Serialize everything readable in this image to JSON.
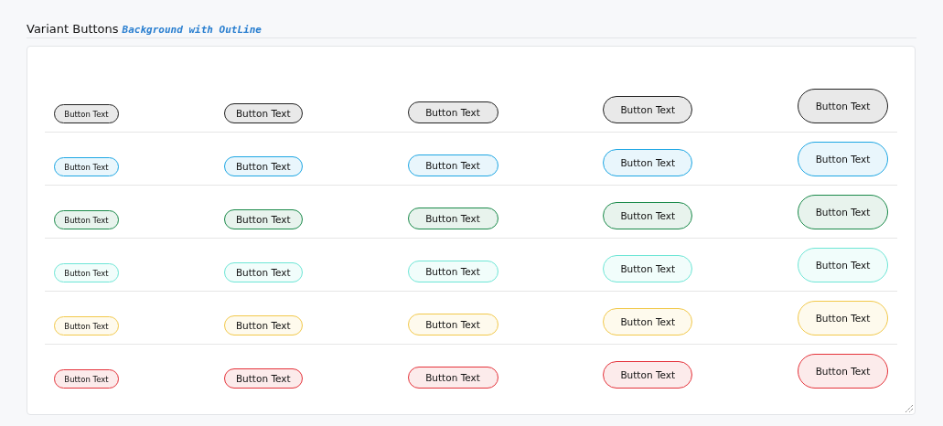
{
  "header": {
    "title": "Variant Buttons",
    "subtitle": "Background with OutLine"
  },
  "rows": [
    {
      "color": "#222222",
      "buttons": [
        {
          "kind": "xs",
          "label": "Button Text"
        },
        {
          "kind": "sm",
          "label": "Button Text"
        },
        {
          "kind": "md",
          "label": "Button Text"
        },
        {
          "kind": "lg",
          "label": "Button Text"
        },
        {
          "kind": "xl",
          "label": "Button Text"
        }
      ]
    },
    {
      "color": "#1ea7e4",
      "buttons": [
        {
          "kind": "xs",
          "label": "Button Text"
        },
        {
          "kind": "sm",
          "label": "Button Text"
        },
        {
          "kind": "md",
          "label": "Button Text"
        },
        {
          "kind": "lg",
          "label": "Button Text"
        },
        {
          "kind": "xl",
          "label": "Button Text"
        }
      ]
    },
    {
      "color": "#1a8a4a",
      "buttons": [
        {
          "kind": "xs",
          "label": "Button Text"
        },
        {
          "kind": "sm",
          "label": "Button Text"
        },
        {
          "kind": "md",
          "label": "Button Text"
        },
        {
          "kind": "lg",
          "label": "Button Text"
        },
        {
          "kind": "xl",
          "label": "Button Text"
        }
      ]
    },
    {
      "color": "#6ee6d6",
      "buttons": [
        {
          "kind": "xs",
          "label": "Button Text"
        },
        {
          "kind": "sm",
          "label": "Button Text"
        },
        {
          "kind": "md",
          "label": "Button Text"
        },
        {
          "kind": "lg",
          "label": "Button Text"
        },
        {
          "kind": "xl",
          "label": "Button Text"
        }
      ]
    },
    {
      "color": "#f2c94c",
      "buttons": [
        {
          "kind": "xs",
          "label": "Button Text"
        },
        {
          "kind": "sm",
          "label": "Button Text"
        },
        {
          "kind": "md",
          "label": "Button Text"
        },
        {
          "kind": "lg",
          "label": "Button Text"
        },
        {
          "kind": "xl",
          "label": "Button Text"
        }
      ]
    },
    {
      "color": "#e5333b",
      "buttons": [
        {
          "kind": "xs",
          "label": "Button Text"
        },
        {
          "kind": "sm",
          "label": "Button Text"
        },
        {
          "kind": "md",
          "label": "Button Text"
        },
        {
          "kind": "lg",
          "label": "Button Text"
        },
        {
          "kind": "xl",
          "label": "Button Text"
        }
      ]
    }
  ]
}
